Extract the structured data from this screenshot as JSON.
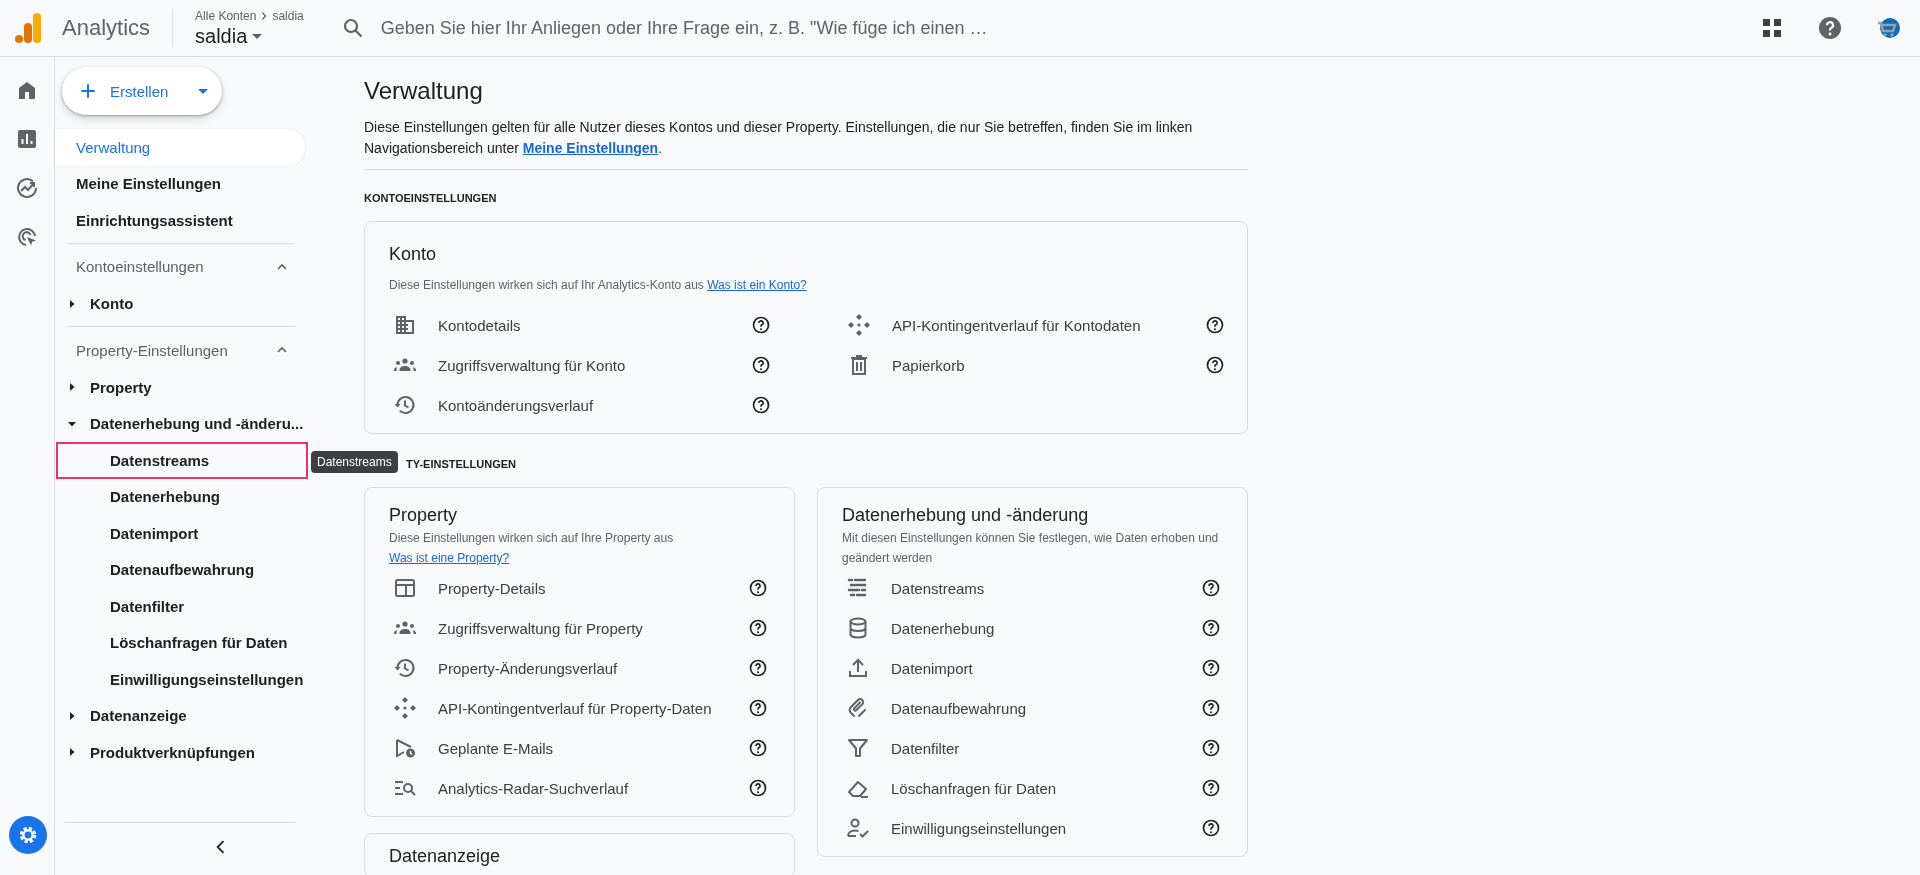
{
  "topbar": {
    "product": "Analytics",
    "breadcrumb": [
      "Alle Konten",
      "saldia"
    ],
    "account": "saldia",
    "search": {
      "placeholder": "Geben Sie hier Ihr Anliegen oder Ihre Frage ein, z. B. \"Wie füge ich einen …"
    }
  },
  "sidebar": {
    "create_button": "Erstellen",
    "nav": [
      {
        "label": "Verwaltung",
        "selected": true
      },
      {
        "label": "Meine Einstellungen",
        "selected": false
      },
      {
        "label": "Einrichtungsassistent",
        "selected": false
      }
    ],
    "sections": [
      {
        "title": "Kontoeinstellungen",
        "expanded": true,
        "items": [
          {
            "label": "Konto",
            "expanded": false
          }
        ]
      },
      {
        "title": "Property-Einstellungen",
        "expanded": true,
        "items": [
          {
            "label": "Property",
            "expanded": false
          },
          {
            "label": "Datenerhebung und -änderu...",
            "expanded": true,
            "children": [
              {
                "label": "Datenstreams",
                "highlighted": true,
                "tooltip": "Datenstreams"
              },
              {
                "label": "Datenerhebung",
                "highlighted": false
              },
              {
                "label": "Datenimport",
                "highlighted": false
              },
              {
                "label": "Datenaufbewahrung",
                "highlighted": false
              },
              {
                "label": "Datenfilter",
                "highlighted": false
              },
              {
                "label": "Löschanfragen für Daten",
                "highlighted": false
              },
              {
                "label": "Einwilligungseinstellungen",
                "highlighted": false
              }
            ]
          },
          {
            "label": "Datenanzeige",
            "expanded": false
          },
          {
            "label": "Produktverknüpfungen",
            "expanded": false
          }
        ]
      }
    ]
  },
  "main": {
    "title": "Verwaltung",
    "description": {
      "text": "Diese Einstellungen gelten für alle Nutzer dieses Kontos und dieser Property. Einstellungen, die nur Sie betreffen, finden Sie im linken Navigationsbereich unter ",
      "link": "Meine Einstellungen",
      "after": "."
    },
    "sections": [
      {
        "heading": "KONTOEINSTELLUNGEN",
        "cards": [
          {
            "title": "Konto",
            "description": "Diese Einstellungen wirken sich auf Ihr Analytics-Konto aus ",
            "link": "Was ist ein Konto?",
            "items": [
              "Kontodetails",
              "API-Kontingentverlauf für Kontodaten",
              "Zugriffsverwaltung für Konto",
              "Papierkorb",
              "Kontoänderungsverlauf"
            ]
          }
        ]
      },
      {
        "heading": "TY-EINSTELLUNGEN",
        "cards": [
          {
            "title": "Property",
            "description": "Diese Einstellungen wirken sich auf Ihre Property aus ",
            "link": "Was ist eine Property?",
            "items": [
              "Property-Details",
              "Zugriffsverwaltung für Property",
              "Property-Änderungsverlauf",
              "API-Kontingentverlauf für Property-Daten",
              "Geplante E-Mails",
              "Analytics-Radar-Suchverlauf"
            ]
          },
          {
            "title": "Datenerhebung und -änderung",
            "description": "Mit diesen Einstellungen können Sie festlegen, wie Daten erhoben und geändert werden",
            "items": [
              "Datenstreams",
              "Datenerhebung",
              "Datenimport",
              "Datenaufbewahrung",
              "Datenfilter",
              "Löschanfragen für Daten",
              "Einwilligungseinstellungen"
            ]
          },
          {
            "title": "Datenanzeige"
          }
        ]
      }
    ]
  }
}
